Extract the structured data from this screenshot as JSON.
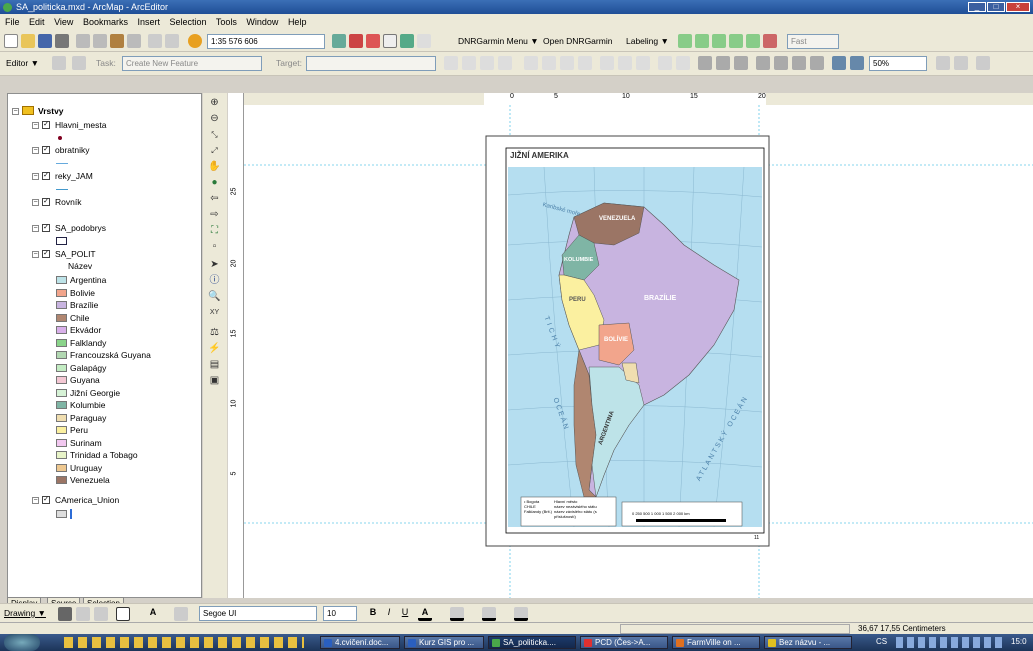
{
  "window": {
    "title": "SA_politicka.mxd - ArcMap - ArcEditor"
  },
  "menu": [
    "File",
    "Edit",
    "View",
    "Bookmarks",
    "Insert",
    "Selection",
    "Tools",
    "Window",
    "Help"
  ],
  "toolbar1": {
    "scale": "1:35 576 606",
    "dnr_menu": "DNRGarmin Menu ▼",
    "open_dnr": "Open DNRGarmin",
    "labeling": "Labeling ▼",
    "fast": "Fast"
  },
  "toolbar2": {
    "editor": "Editor ▼",
    "task_label": "Task:",
    "task_value": "Create New Feature",
    "target_label": "Target:",
    "zoom": "50%"
  },
  "toc": {
    "root": "Vrstvy",
    "layers": [
      "Hlavni_mesta",
      "obratniky",
      "reky_JAM",
      "Rovník",
      "SA_podobrys",
      "SA_POLIT",
      "CAmerica_Union"
    ],
    "field": "Název",
    "countries": [
      {
        "name": "Argentina",
        "color": "#bde3e8"
      },
      {
        "name": "Bolivie",
        "color": "#f2a58c"
      },
      {
        "name": "Brazílie",
        "color": "#c8b4e0"
      },
      {
        "name": "Chile",
        "color": "#b08670"
      },
      {
        "name": "Ekvádor",
        "color": "#d9b0ea"
      },
      {
        "name": "Falklandy",
        "color": "#8ad48a"
      },
      {
        "name": "Francouzská Guyana",
        "color": "#b2d8b2"
      },
      {
        "name": "Galapágy",
        "color": "#c3ecc3"
      },
      {
        "name": "Guyana",
        "color": "#f4c8d4"
      },
      {
        "name": "Jižní Georgie",
        "color": "#d6f2d6"
      },
      {
        "name": "Kolumbie",
        "color": "#7fb5a5"
      },
      {
        "name": "Paraguay",
        "color": "#f0deb0"
      },
      {
        "name": "Peru",
        "color": "#fbf0a0"
      },
      {
        "name": "Surinam",
        "color": "#f2c8f0"
      },
      {
        "name": "Trinidad a Tobago",
        "color": "#e8f4c8"
      },
      {
        "name": "Uruguay",
        "color": "#eec890"
      },
      {
        "name": "Venezuela",
        "color": "#9b7565"
      }
    ]
  },
  "toc_tabs": [
    "Display",
    "Source",
    "Selection"
  ],
  "ruler": {
    "h": [
      "0",
      "5",
      "10",
      "15",
      "20"
    ],
    "v": [
      "25",
      "20",
      "15",
      "10",
      "5"
    ]
  },
  "map": {
    "title": "JIŽNÍ AMERIKA",
    "labels": [
      "VENEZUELA",
      "KOLUMBIE",
      "PERU",
      "BRAZÍLIE",
      "BOLÍVIE",
      "ARGENTINA",
      "TICHÝ",
      "O C E Á N",
      "ATLANTSKÝ OCEÁN",
      "Karibské moře"
    ],
    "legend": {
      "capital": "Hlavní město",
      "state": "název nezávislého státu",
      "dependent": "název závislého státu (s příslušností)",
      "scale": "0  250 500  1 000  1 500  2 000 km",
      "row_labels": [
        "• Bogota",
        "CHILE",
        "Falklandy (Brit.)"
      ]
    },
    "page_no": "11"
  },
  "drawbar": {
    "drawing": "Drawing ▼",
    "font": "Segoe UI",
    "size": "10"
  },
  "status": {
    "coords": "36,67  17,55 Centimeters"
  },
  "taskbar": {
    "items": [
      "4.cvičení.doc...",
      "Kurz GIS pro ...",
      "SA_politicka....",
      "PCD (Čes->A...",
      "FarmVille on ...",
      "Bez názvu - ..."
    ],
    "lang": "CS",
    "clock": "15:0"
  }
}
